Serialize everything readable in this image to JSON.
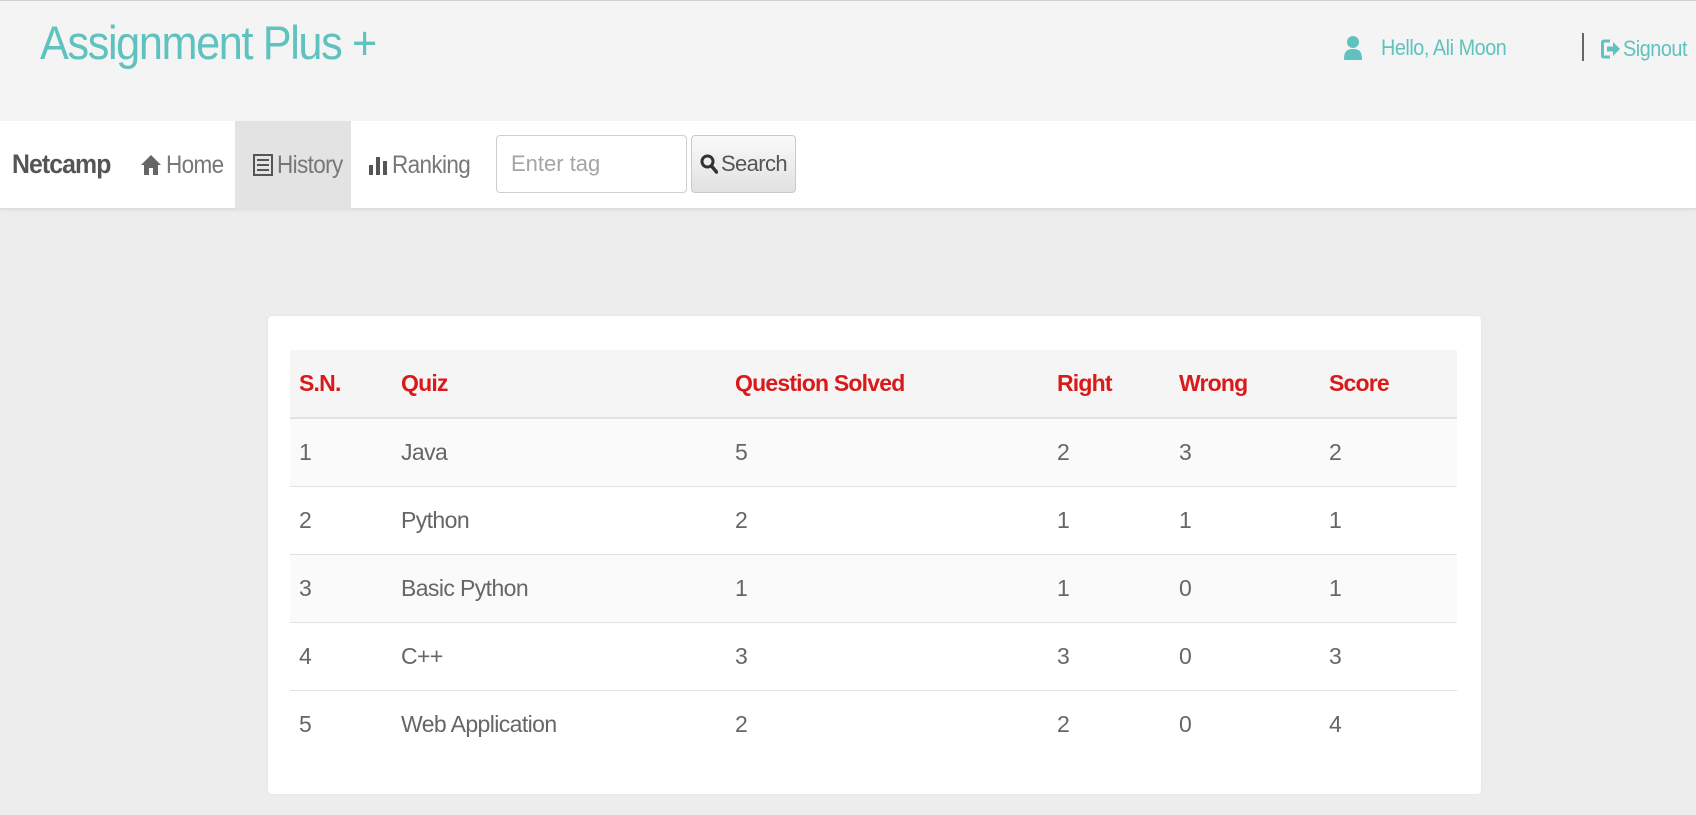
{
  "header": {
    "brand": "Assignment Plus +",
    "greeting": "Hello,  Ali Moon",
    "signout": "Signout"
  },
  "navbar": {
    "brand": "Netcamp",
    "items": [
      {
        "label": "Home",
        "icon": "home-icon"
      },
      {
        "label": "History",
        "icon": "list-icon",
        "active": true
      },
      {
        "label": "Ranking",
        "icon": "bar-chart-icon"
      }
    ],
    "search": {
      "placeholder": "Enter tag",
      "value": "",
      "button": "Search"
    }
  },
  "table": {
    "columns": [
      "S.N.",
      "Quiz",
      "Question Solved",
      "Right",
      "Wrong",
      "Score"
    ],
    "rows": [
      [
        "1",
        "Java",
        "5",
        "2",
        "3",
        "2"
      ],
      [
        "2",
        "Python",
        "2",
        "1",
        "1",
        "1"
      ],
      [
        "3",
        "Basic Python",
        "1",
        "1",
        "0",
        "1"
      ],
      [
        "4",
        "C++",
        "3",
        "3",
        "0",
        "3"
      ],
      [
        "5",
        "Web Application",
        "2",
        "2",
        "0",
        "4"
      ]
    ]
  },
  "colors": {
    "accent": "#5fc2bf",
    "header_text": "#d91a1a",
    "active_nav": "#e3e3e3"
  }
}
